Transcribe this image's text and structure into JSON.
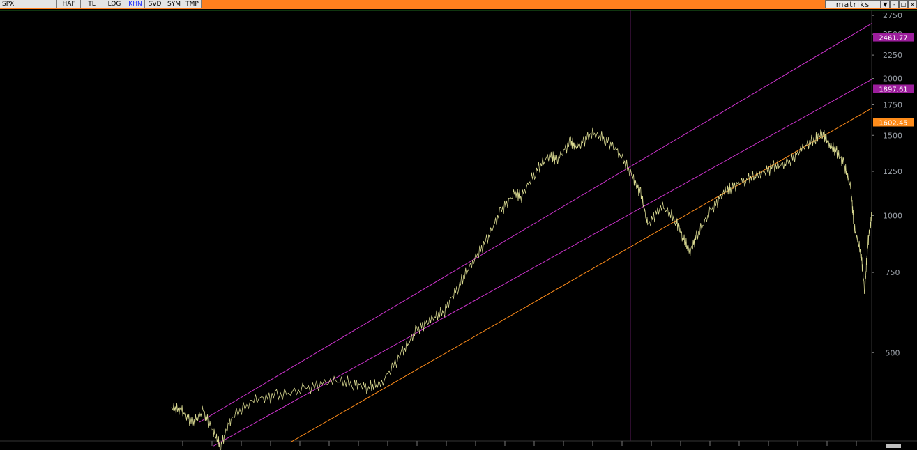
{
  "toolbar": {
    "symbol": "SPX",
    "buttons": [
      "HAF",
      "TL",
      "LOG",
      "KHN",
      "SVD",
      "SYM",
      "TMP"
    ],
    "active_button": "KHN",
    "brand": "matriks",
    "controls": [
      "▼",
      "-",
      "□",
      "×"
    ]
  },
  "chart_data": {
    "type": "line",
    "scale": "log",
    "yaxis_side": "right",
    "grid": false,
    "ylim": [
      320,
      2800
    ],
    "y_ticks": [
      500,
      750,
      1000,
      1250,
      1500,
      1750,
      2000,
      2250,
      2500,
      2750
    ],
    "price_labels": [
      {
        "text": "2461.77",
        "value": 2461.77,
        "color": "#9c1e9c"
      },
      {
        "text": "1897.61",
        "value": 1897.61,
        "color": "#9c1e9c"
      },
      {
        "text": "1602.45",
        "value": 1602.45,
        "color": "#ff8c1a"
      }
    ],
    "trend_lines": [
      {
        "color": "#cc33cc",
        "points": [
          [
            0.04,
            352
          ],
          [
            1.0,
            2640
          ]
        ]
      },
      {
        "color": "#cc33cc",
        "points": [
          [
            0.06,
            312
          ],
          [
            1.0,
            1990
          ]
        ]
      },
      {
        "color": "#ff8c1a",
        "points": [
          [
            0.17,
            318
          ],
          [
            1.0,
            1720
          ]
        ]
      }
    ],
    "series": [
      {
        "color": "#d8d890",
        "points": [
          [
            0.0,
            380
          ],
          [
            0.015,
            372
          ],
          [
            0.03,
            350
          ],
          [
            0.045,
            372
          ],
          [
            0.06,
            335
          ],
          [
            0.07,
            310
          ],
          [
            0.085,
            360
          ],
          [
            0.12,
            395
          ],
          [
            0.15,
            402
          ],
          [
            0.19,
            415
          ],
          [
            0.23,
            435
          ],
          [
            0.26,
            428
          ],
          [
            0.28,
            420
          ],
          [
            0.3,
            428
          ],
          [
            0.33,
            500
          ],
          [
            0.35,
            560
          ],
          [
            0.37,
            590
          ],
          [
            0.39,
            620
          ],
          [
            0.41,
            700
          ],
          [
            0.43,
            790
          ],
          [
            0.45,
            880
          ],
          [
            0.47,
            1020
          ],
          [
            0.49,
            1120
          ],
          [
            0.5,
            1100
          ],
          [
            0.52,
            1250
          ],
          [
            0.54,
            1360
          ],
          [
            0.55,
            1320
          ],
          [
            0.57,
            1450
          ],
          [
            0.58,
            1410
          ],
          [
            0.6,
            1520
          ],
          [
            0.62,
            1470
          ],
          [
            0.64,
            1370
          ],
          [
            0.66,
            1200
          ],
          [
            0.67,
            1120
          ],
          [
            0.68,
            950
          ],
          [
            0.7,
            1050
          ],
          [
            0.72,
            980
          ],
          [
            0.73,
            900
          ],
          [
            0.74,
            830
          ],
          [
            0.75,
            900
          ],
          [
            0.77,
            1020
          ],
          [
            0.79,
            1130
          ],
          [
            0.8,
            1150
          ],
          [
            0.82,
            1200
          ],
          [
            0.84,
            1230
          ],
          [
            0.86,
            1280
          ],
          [
            0.88,
            1300
          ],
          [
            0.9,
            1400
          ],
          [
            0.92,
            1480
          ],
          [
            0.93,
            1520
          ],
          [
            0.94,
            1430
          ],
          [
            0.95,
            1380
          ],
          [
            0.96,
            1300
          ],
          [
            0.97,
            1150
          ],
          [
            0.975,
            940
          ],
          [
            0.985,
            820
          ],
          [
            0.99,
            680
          ],
          [
            0.995,
            880
          ],
          [
            1.0,
            1000
          ]
        ]
      }
    ]
  }
}
